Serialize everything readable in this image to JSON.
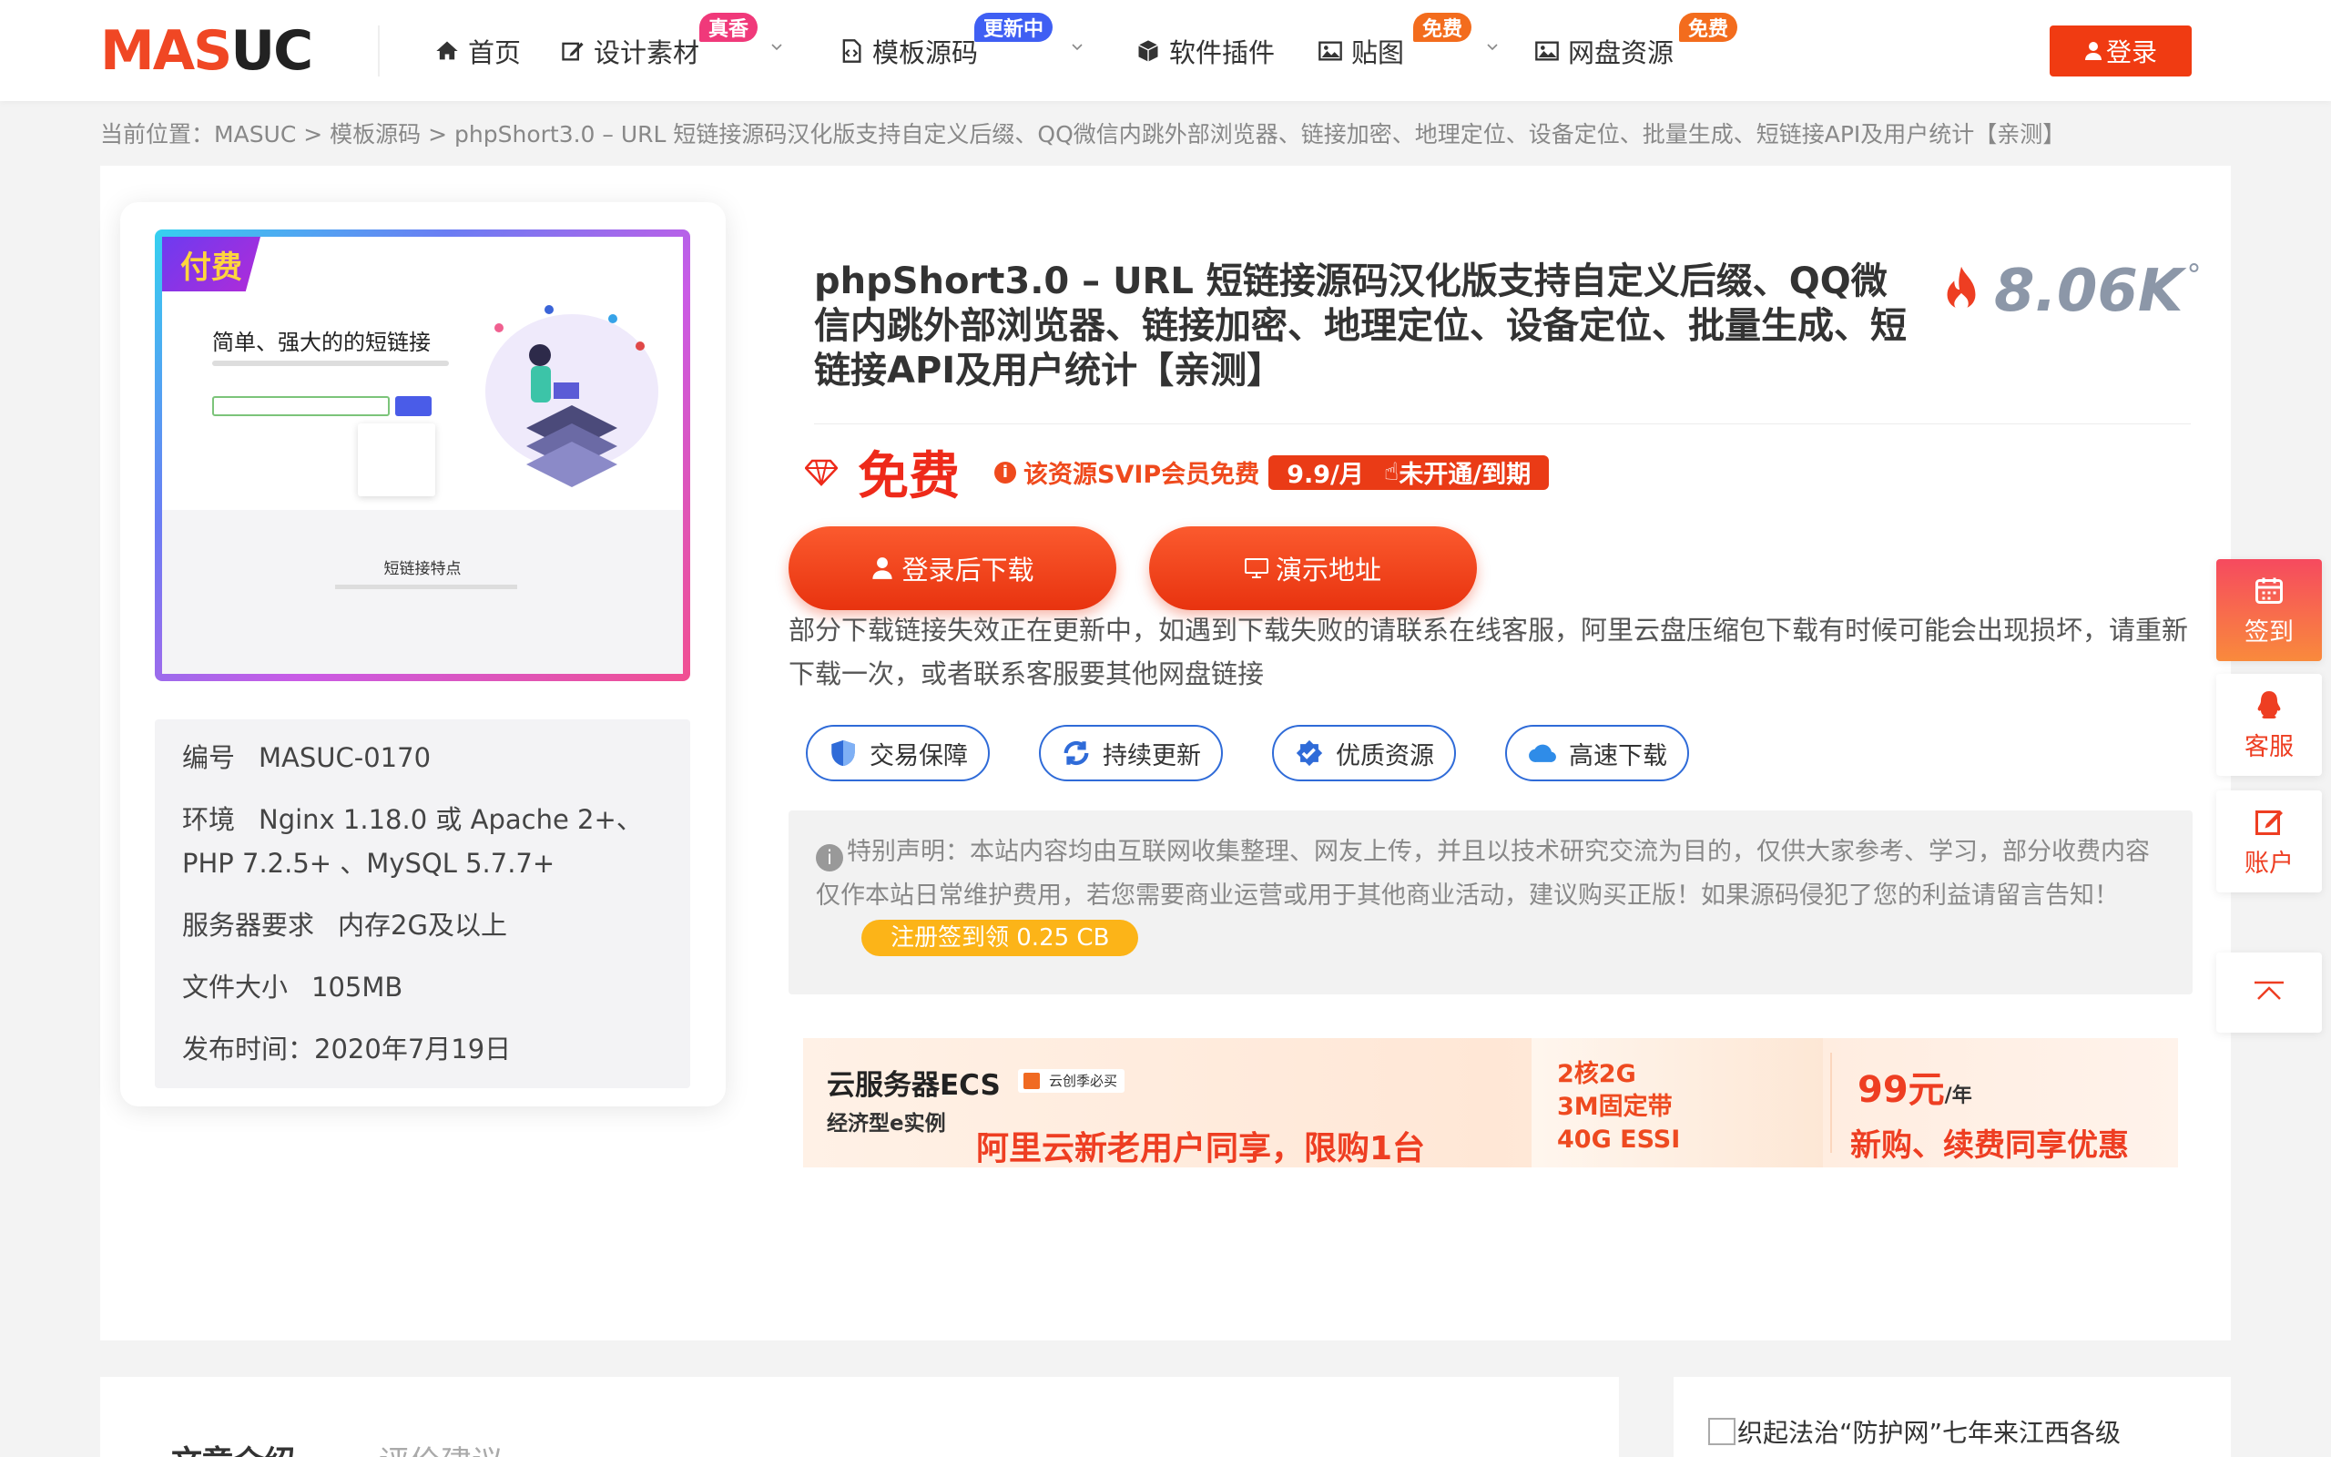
{
  "header": {
    "logo_main": "MAS",
    "logo_tail": "UC",
    "nav": [
      {
        "label": "首页",
        "icon": "home-icon"
      },
      {
        "label": "设计素材",
        "icon": "edit-icon",
        "badge": "真香"
      },
      {
        "label": "模板源码",
        "icon": "file-code-icon",
        "badge": "更新中"
      },
      {
        "label": "软件插件",
        "icon": "cube-icon"
      },
      {
        "label": "贴图",
        "icon": "image-icon",
        "badge": "免费"
      },
      {
        "label": "网盘资源",
        "icon": "image-icon",
        "badge": "免费"
      }
    ],
    "login_label": "登录"
  },
  "breadcrumb": {
    "prefix": "当前位置：",
    "home": "MASUC",
    "sep": " > ",
    "category": "模板源码",
    "current": "phpShort3.0 – URL 短链接源码汉化版支持自定义后缀、QQ微信内跳外部浏览器、链接加密、地理定位、设备定位、批量生成、短链接API及用户统计【亲测】"
  },
  "thumbnail": {
    "paid_tag": "付费",
    "headline": "简单、强大的的短链接",
    "section_title": "短链接特点"
  },
  "specs": [
    {
      "key": "编号",
      "value": "MASUC-0170"
    },
    {
      "key": "环境",
      "value": "Nginx 1.18.0 或 Apache 2+、PHP 7.2.5+ 、MySQL 5.7.7+"
    },
    {
      "key": "服务器要求",
      "value": "内存2G及以上"
    },
    {
      "key": "文件大小",
      "value": "105MB"
    },
    {
      "key": "发布时间：",
      "value": "2020年7月19日"
    }
  ],
  "title": "phpShort3.0 – URL 短链接源码汉化版支持自定义后缀、QQ微信内跳外部浏览器、链接加密、地理定位、设备定位、批量生成、短链接API及用户统计【亲测】",
  "views": {
    "value": "8.06K",
    "deg": "°"
  },
  "price": {
    "label": "免费",
    "svip_note": "该资源SVIP会员免费",
    "svip_price": "9.9/月",
    "svip_status": "未开通/到期"
  },
  "buttons": {
    "download": "登录后下载",
    "demo": "演示地址"
  },
  "notice": "部分下载链接失效正在更新中，如遇到下载失败的请联系在线客服，阿里云盘压缩包下载有时候可能会出现损坏，请重新下载一次，或者联系客服要其他网盘链接",
  "features": [
    {
      "label": "交易保障",
      "icon": "shield-icon"
    },
    {
      "label": "持续更新",
      "icon": "refresh-icon"
    },
    {
      "label": "优质资源",
      "icon": "badge-check-icon"
    },
    {
      "label": "高速下载",
      "icon": "cloud-icon"
    }
  ],
  "declaration": {
    "text": "特别声明：本站内容均由互联网收集整理、网友上传，并且以技术研究交流为目的，仅供大家参考、学习，部分收费内容仅作本站日常维护费用，若您需要商业运营或用于其他商业活动，建议购买正版！如果源码侵犯了您的利益请留言告知！",
    "cb_pill": "注册签到领 0.25 CB"
  },
  "ad": {
    "title": "云服务器ECS",
    "tag": "云创季必买",
    "subtitle": "经济型e实例",
    "slogan": "阿里云新老用户同享，限购1台",
    "spec1": "2核2G",
    "spec2": "3M固定带",
    "spec3": "40G ESSI",
    "price": "99元",
    "per": "/年",
    "promo": "新购、续费同享优惠"
  },
  "lower": {
    "tab1": "文章介绍",
    "tab2": "评价建议",
    "side_caption": "织起法治“防护网”七年来江西各级"
  },
  "sidebar": {
    "checkin": "签到",
    "service": "客服",
    "account": "账户"
  },
  "colors": {
    "brand": "#f04724",
    "accent": "#ee3e22",
    "blue": "#2f6bd8"
  }
}
